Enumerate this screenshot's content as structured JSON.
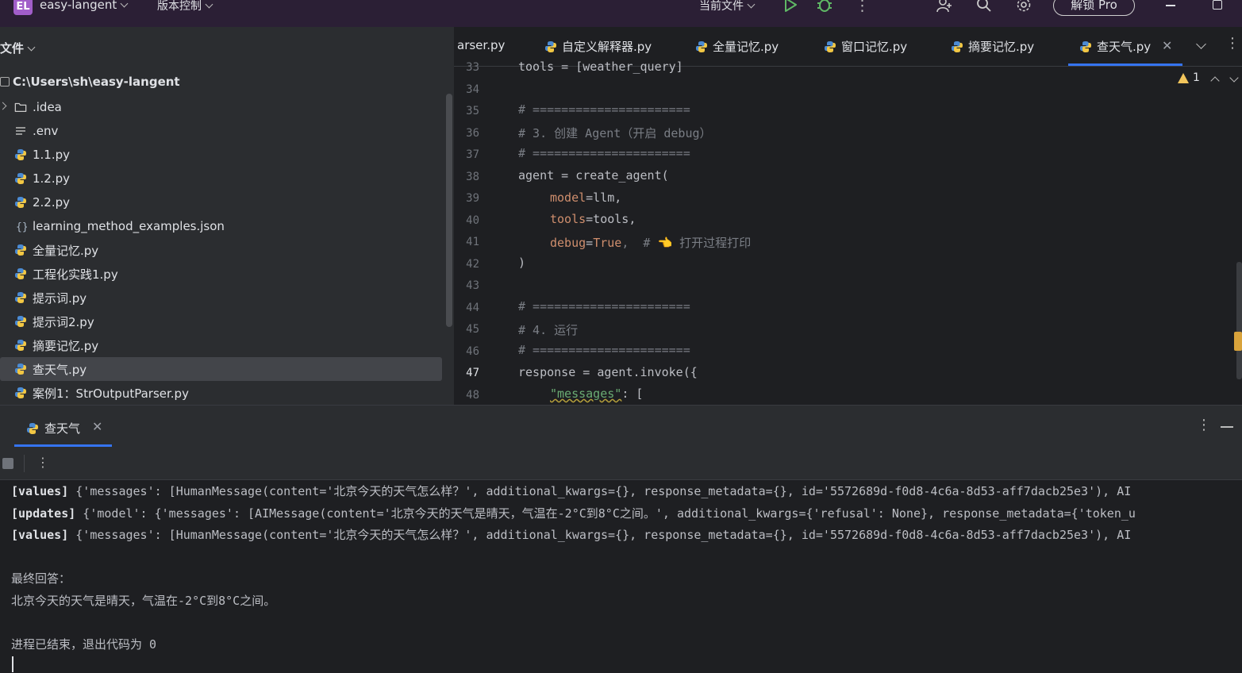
{
  "titlebar": {
    "badge": "EL",
    "project": "easy-langent",
    "vcs": "版本控制",
    "current_file": "当前文件",
    "pro_button": "解锁 Pro",
    "icons": [
      "run-icon",
      "debug-icon",
      "more-icon",
      "add-user-icon",
      "search-icon",
      "settings-icon"
    ]
  },
  "project_panel": {
    "title": "文件",
    "root": "C:\\Users\\sh\\easy-langent",
    "items": [
      {
        "label": ".idea",
        "icon": "folder-icon"
      },
      {
        "label": ".env",
        "icon": "text-file-icon"
      },
      {
        "label": "1.1.py",
        "icon": "python-icon"
      },
      {
        "label": "1.2.py",
        "icon": "python-icon"
      },
      {
        "label": "2.2.py",
        "icon": "python-icon"
      },
      {
        "label": "learning_method_examples.json",
        "icon": "json-icon"
      },
      {
        "label": "全量记忆.py",
        "icon": "python-icon"
      },
      {
        "label": "工程化实践1.py",
        "icon": "python-icon"
      },
      {
        "label": "提示词.py",
        "icon": "python-icon"
      },
      {
        "label": "提示词2.py",
        "icon": "python-icon"
      },
      {
        "label": "摘要记忆.py",
        "icon": "python-icon"
      },
      {
        "label": "查天气.py",
        "icon": "python-icon"
      },
      {
        "label": "案例1：StrOutputParser.py",
        "icon": "python-icon"
      }
    ]
  },
  "editor": {
    "tabs": [
      {
        "label": "arser.py"
      },
      {
        "label": "自定义解释器.py"
      },
      {
        "label": "全量记忆.py"
      },
      {
        "label": "窗口记忆.py"
      },
      {
        "label": "摘要记忆.py"
      },
      {
        "label": "查天气.py"
      }
    ],
    "warning_count": "1",
    "line_numbers": [
      "33",
      "34",
      "35",
      "36",
      "37",
      "38",
      "39",
      "40",
      "41",
      "42",
      "43",
      "44",
      "45",
      "46",
      "47",
      "48"
    ],
    "code": {
      "l33": "tools = [weather_query]",
      "l35": "# ======================",
      "l36": "# 3. 创建 Agent（开启 debug）",
      "l37": "# ======================",
      "l38": "agent = create_agent(",
      "l39_param": "model",
      "l39_rest": "=llm,",
      "l40_param": "tools",
      "l40_rest": "=tools,",
      "l41_param": "debug",
      "l41_eq": "=",
      "l41_kw": "True",
      "l41_rest": ",  # ",
      "l41_emoji": "👈",
      "l41_comment": " 打开过程打印",
      "l42": ")",
      "l44": "# ======================",
      "l45": "# 4. 运行",
      "l46": "# ======================",
      "l47": "response = agent.invoke({",
      "l48_str": "\"messages\"",
      "l48_rest": ": ["
    }
  },
  "run_panel": {
    "tab": "查天气",
    "console": [
      {
        "tag": "[values]",
        "text": " {'messages': [HumanMessage(content='北京今天的天气怎么样？', additional_kwargs={}, response_metadata={}, id='5572689d-f0d8-4c6a-8d53-aff7dacb25e3'), AI"
      },
      {
        "tag": "[updates]",
        "text": " {'model': {'messages': [AIMessage(content='北京今天的天气是晴天，气温在-2°C到8°C之间。', additional_kwargs={'refusal': None}, response_metadata={'token_u"
      },
      {
        "tag": "[values]",
        "text": " {'messages': [HumanMessage(content='北京今天的天气怎么样？', additional_kwargs={}, response_metadata={}, id='5572689d-f0d8-4c6a-8d53-aff7dacb25e3'), AI"
      }
    ],
    "final_label": "最终回答：",
    "final_answer": "北京今天的天气是晴天，气温在-2°C到8°C之间。",
    "exit_message": "进程已结束，退出代码为 0"
  },
  "colors": {
    "accent": "#3574f0",
    "badge": "#a15ec9",
    "run_green": "#5fb865",
    "warning": "#f2c55c"
  }
}
